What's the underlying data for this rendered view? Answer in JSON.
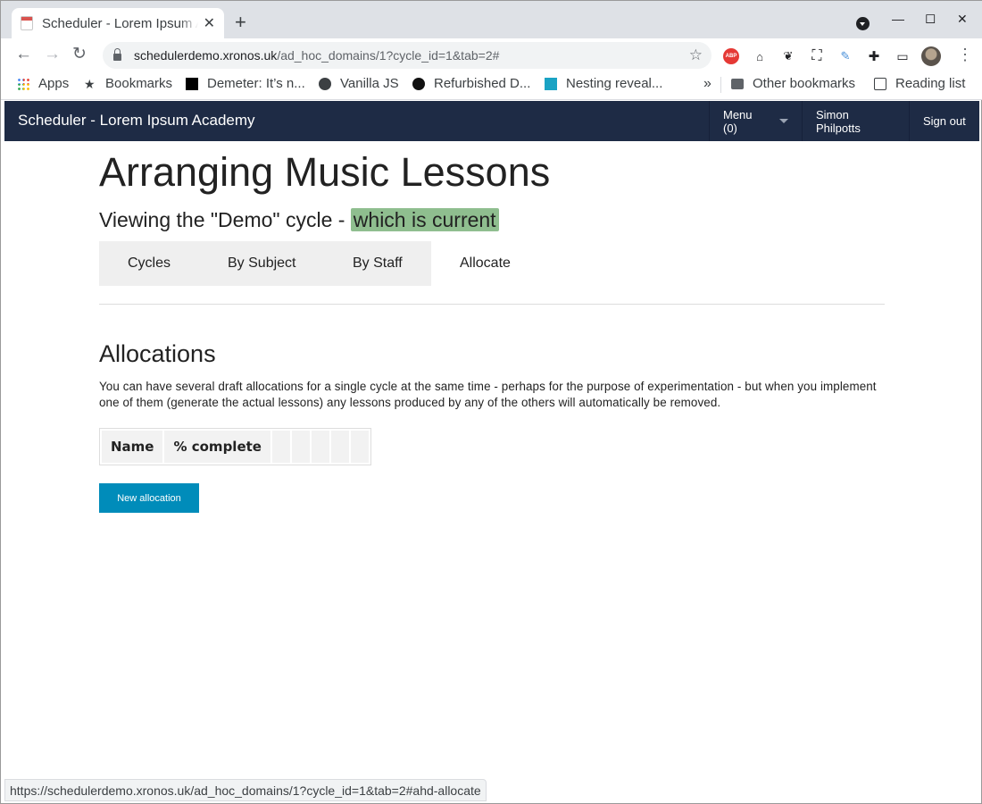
{
  "browser": {
    "tab_title": "Scheduler - Lorem Ipsum Academy",
    "new_tab_label": "+",
    "url_host": "schedulerdemo.xronos.uk",
    "url_path": "/ad_hoc_domains/1?cycle_id=1&tab=2#",
    "bookmarks": [
      {
        "label": "Apps",
        "icon": "apps-grid-icon"
      },
      {
        "label": "Bookmarks",
        "icon": "star-icon"
      },
      {
        "label": "Demeter: It’s n...",
        "icon": "square-icon"
      },
      {
        "label": "Vanilla JS",
        "icon": "globe-icon"
      },
      {
        "label": "Refurbished D...",
        "icon": "info-circle-icon"
      },
      {
        "label": "Nesting reveal...",
        "icon": "f-square-icon"
      }
    ],
    "overflow_label": "»",
    "other_bookmarks": "Other bookmarks",
    "reading_list": "Reading list",
    "status_url": "https://schedulerdemo.xronos.uk/ad_hoc_domains/1?cycle_id=1&tab=2#ahd-allocate"
  },
  "site": {
    "title": "Scheduler - Lorem Ipsum Academy",
    "menu_label": "Menu (0)",
    "user_name": "Simon Philpotts",
    "sign_out": "Sign out"
  },
  "page": {
    "heading": "Arranging Music Lessons",
    "subtitle_prefix": "Viewing the \"Demo\" cycle - ",
    "subtitle_highlight": "which is current",
    "tabs": [
      "Cycles",
      "By Subject",
      "By Staff",
      "Allocate"
    ],
    "active_tab": "Allocate",
    "section_heading": "Allocations",
    "description": "You can have several draft allocations for a single cycle at the same time - perhaps for the purpose of experimentation - but when you implement one of them (generate the actual lessons) any lessons produced by any of the others will automatically be removed.",
    "table_headers": [
      "Name",
      "% complete"
    ],
    "new_button": "New allocation"
  },
  "colors": {
    "navbar": "#1e2b45",
    "highlight": "#8fbe8f",
    "button": "#008cba"
  }
}
